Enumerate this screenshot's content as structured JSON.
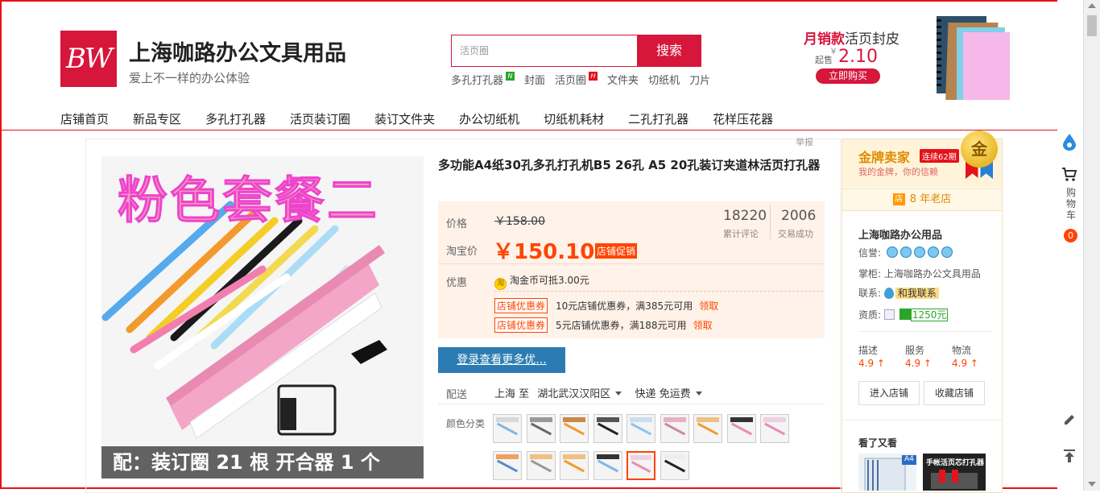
{
  "header": {
    "logo_text": "BW",
    "shop_name": "上海咖路办公文具用品",
    "slogan": "爱上不一样的办公体验",
    "search_placeholder": "活页圈",
    "search_button": "搜索",
    "hot_words": [
      {
        "text": "多孔打孔器",
        "tag": "N"
      },
      {
        "text": "封面",
        "tag": ""
      },
      {
        "text": "活页圈",
        "tag": "H"
      },
      {
        "text": "文件夹",
        "tag": ""
      },
      {
        "text": "切纸机",
        "tag": ""
      },
      {
        "text": "刀片",
        "tag": ""
      }
    ],
    "promo": {
      "title_bold": "月销款",
      "title_rest": "活页封皮",
      "from_label": "起售",
      "currency": "￥",
      "price": "2.10",
      "buy_button": "立即购买"
    }
  },
  "nav": [
    "店铺首页",
    "新品专区",
    "多孔打孔器",
    "活页装订圈",
    "装订文件夹",
    "办公切纸机",
    "切纸机耗材",
    "二孔打孔器",
    "花样压花器"
  ],
  "product": {
    "report": "举报",
    "gallery_title": "粉色套餐二",
    "gallery_caption": "配：装订圈 21 根  开合器 1 个",
    "title": "多功能A4纸30孔多孔打孔机B5 26孔 A5 20孔装订夹道林活页打孔器",
    "price_label": "价格",
    "original_price": "￥158.00",
    "reviews_count": "18220",
    "reviews_label": "累计评论",
    "deals_count": "2006",
    "deals_label": "交易成功",
    "taobao_price_label": "淘宝价",
    "price": "￥150.10",
    "price_tag": "店铺促销",
    "discount_label": "优惠",
    "coin_icon_text": "淘",
    "coin_text": "淘金币可抵3.00元",
    "coupons": [
      {
        "tag": "店铺优惠券",
        "text": "10元店铺优惠券，满385元可用",
        "action": "领取"
      },
      {
        "tag": "店铺优惠券",
        "text": "5元店铺优惠券，满188元可用",
        "action": "领取"
      }
    ],
    "login_button": "登录查看更多优...",
    "shipping_label": "配送",
    "ship_from": "上海 至",
    "ship_to": "湖北武汉汉阳区",
    "ship_method": "快递 免运费",
    "color_label": "颜色分类",
    "swatches": [
      {
        "band": "#d8d8d8",
        "stripe": "#7cb8e8",
        "selected": false
      },
      {
        "band": "#999999",
        "stripe": "#666666",
        "selected": false
      },
      {
        "band": "#cc8844",
        "stripe": "#f39a2c",
        "selected": false
      },
      {
        "band": "#555555",
        "stripe": "#222222",
        "selected": false
      },
      {
        "band": "#c9dff0",
        "stripe": "#89c4ef",
        "selected": false
      },
      {
        "band": "#e8b0c0",
        "stripe": "#cc8899",
        "selected": false
      },
      {
        "band": "#f0c080",
        "stripe": "#f39a2c",
        "selected": false
      },
      {
        "band": "#333333",
        "stripe": "#e98ab3",
        "selected": false
      },
      {
        "band": "#f0d0e0",
        "stripe": "#e98ab3",
        "selected": false
      },
      {
        "band": "#f0a060",
        "stripe": "#5a8ad0",
        "selected": false
      },
      {
        "band": "#f0c080",
        "stripe": "#999999",
        "selected": false
      },
      {
        "band": "#f0c080",
        "stripe": "#f39a2c",
        "selected": false
      },
      {
        "band": "#333333",
        "stripe": "#7cb8e8",
        "selected": false
      },
      {
        "band": "#f0d0e0",
        "stripe": "#e98ab3",
        "selected": true
      },
      {
        "band": "#eeeeee",
        "stripe": "#222222",
        "selected": false
      }
    ]
  },
  "seller": {
    "badge_title": "金牌卖家",
    "badge_streak": "连续62期",
    "badge_sub": "我的金牌，你的信赖",
    "medal_text": "金",
    "years_icon": "店",
    "years": "8 年老店",
    "store_name": "上海咖路办公用品",
    "credit_label": "信誉:",
    "owner_label": "掌柜:",
    "owner": "上海咖路办公文具用品",
    "contact_label": "联系:",
    "contact_button": "和我联系",
    "qualification_label": "资质:",
    "deposit": "1250元",
    "scores": [
      {
        "label": "描述",
        "value": "4.9"
      },
      {
        "label": "服务",
        "value": "4.9"
      },
      {
        "label": "物流",
        "value": "4.9"
      }
    ],
    "enter_button": "进入店铺",
    "favorite_button": "收藏店铺",
    "also_viewed": "看了又看",
    "also_thumb_1": "A4",
    "also_thumb_2": "手帐活页芯打孔器"
  },
  "toolbar": {
    "cart_label": "购物车",
    "cart_count": "0"
  },
  "colors": {
    "brand_red": "#d6163b",
    "price_orange": "#ff4400",
    "login_blue": "#2c7cb3"
  }
}
